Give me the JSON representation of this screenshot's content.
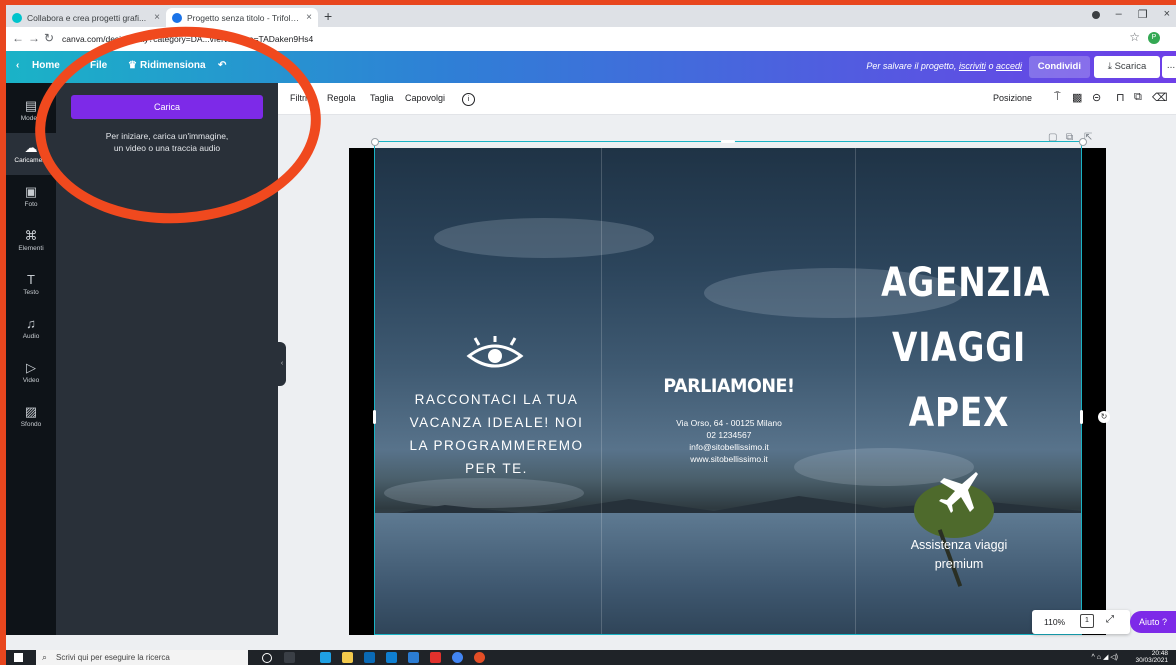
{
  "browser": {
    "tabs": [
      {
        "title": "Collabora e crea progetti grafi..."
      },
      {
        "title": "Progetto senza titolo - Trifold Br..."
      }
    ],
    "new_tab_symbol": "+",
    "url": "canva.com/design/play?category=DA...vfeNo&type=TADaken9Hs4",
    "profile_initial": "P"
  },
  "header": {
    "back_label": "Home",
    "file_label": "File",
    "resize_label": "Ridimensiona",
    "save_prompt_prefix": "Per salvare il progetto,",
    "signup_link": "iscriviti",
    "or_word": "o",
    "login_link": "accedi",
    "share_label": "Condividi",
    "download_label": "Scarica",
    "more_label": "..."
  },
  "rail": {
    "items": [
      {
        "label": "Modelli",
        "icon": "template-icon"
      },
      {
        "label": "Caricame...",
        "icon": "upload-cloud-icon"
      },
      {
        "label": "Foto",
        "icon": "photo-icon"
      },
      {
        "label": "Elementi",
        "icon": "elements-icon"
      },
      {
        "label": "Testo",
        "icon": "text-icon"
      },
      {
        "label": "Audio",
        "icon": "audio-icon"
      },
      {
        "label": "Video",
        "icon": "video-icon"
      },
      {
        "label": "Sfondo",
        "icon": "background-icon"
      }
    ]
  },
  "panel": {
    "upload_label": "Carica",
    "hint_line1": "Per iniziare, carica un'immagine,",
    "hint_line2": "un video o una traccia audio"
  },
  "toolbar": {
    "filter_label": "Filtri",
    "adjust_label": "Regola",
    "crop_label": "Taglia",
    "flip_label": "Capovolgi",
    "position_label": "Posizione"
  },
  "design": {
    "left_text": "RACCONTACI LA TUA VACANZA IDEALE! NOI LA PROGRAMMEREMO PER TE.",
    "contact_title": "PARLIAMONE!",
    "address": "Via Orso, 64 - 00125 Milano",
    "phone": "02 1234567",
    "email": "info@sitobellissimo.it",
    "website": "www.sitobellissimo.it",
    "brand_line1": "AGENZIA",
    "brand_line2": "VIAGGI",
    "brand_line3": "APEX",
    "tagline_line1": "Assistenza viaggi",
    "tagline_line2": "premium"
  },
  "zoom": {
    "value": "110%",
    "page_number": "1"
  },
  "help_label": "Aiuto ?",
  "taskbar": {
    "search_placeholder": "Scrivi qui per eseguire la ricerca",
    "time": "20:48",
    "date": "30/03/2021"
  },
  "colors": {
    "frame_background": "#E8461E",
    "annotation_ring": "#F0491E",
    "accent_purple": "#7D2AE8",
    "selection_cyan": "#19B3C4"
  }
}
